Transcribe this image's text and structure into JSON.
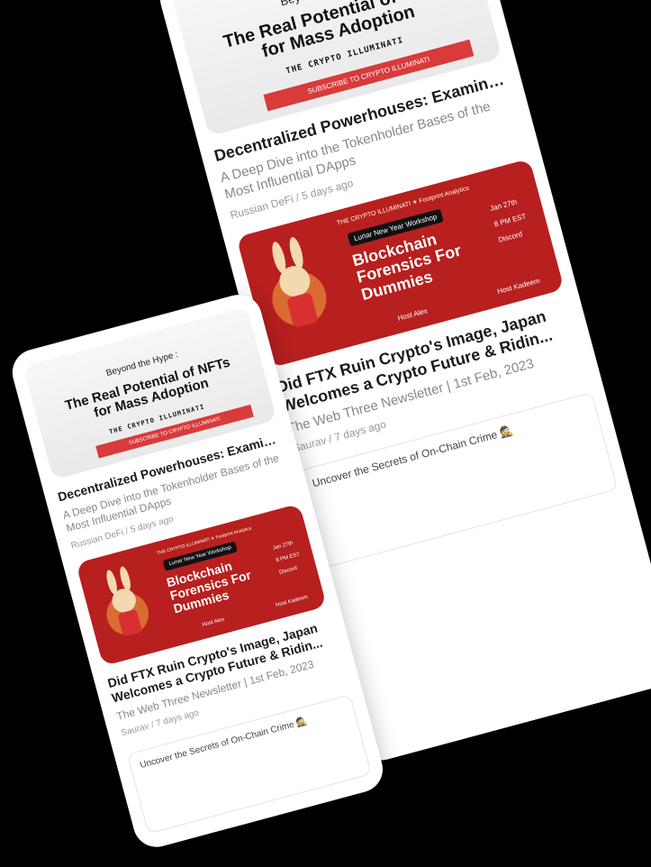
{
  "posts": [
    {
      "thumb": {
        "pre_title": "Beyond the Hype :",
        "main_title": "The Real Potential of NFTs for Mass Adoption",
        "brand": "THE CRYPTO ILLUMINATI",
        "subscribe": "SUBSCRIBE TO CRYPTO ILLUMINATI"
      },
      "title": "Decentralized Powerhouses: Examining the Top DApp Tokens...",
      "desc": "A Deep Dive into the Tokenholder Bases of the Most Influential DApps",
      "author": "Russian DeFi",
      "age": "5 days ago"
    },
    {
      "thumb": {
        "header": "THE CRYPTO ILLUMINATI  ✶ Footprint Analytics",
        "workshop": "Lunar New Year Workshop",
        "title": "Blockchain Forensics For Dummies",
        "date": "Jan 27th",
        "time": "8 PM EST",
        "platform": "Discord",
        "speaker1": "Host Alex",
        "speaker2": "Host Kadeem"
      },
      "title_line1": "Did FTX Ruin Crypto's Image, Japan",
      "title_line2": "Welcomes a Crypto Future & Ridin...",
      "desc": "The Web Three Newsletter | 1st Feb, 2023",
      "author": "Saurav",
      "age": "7 days ago"
    },
    {
      "alt": "Uncover the Secrets of On-Chain Crime 🕵️"
    }
  ],
  "colors": {
    "card": "#ffffff",
    "accent_red": "#b81f1f"
  }
}
